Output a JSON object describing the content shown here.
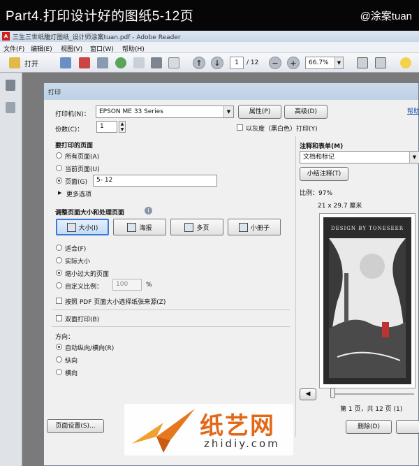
{
  "banner": {
    "title": "Part4.打印设计好的图纸5-12页",
    "author": "@涂案tuan"
  },
  "window": {
    "title": "三生三世纸雕灯图纸_设计师涂案tuan.pdf - Adobe Reader"
  },
  "menu": [
    "文件(F)",
    "编辑(E)",
    "视图(V)",
    "窗口(W)",
    "帮助(H)"
  ],
  "toolbar": {
    "open_label": "打开",
    "page_current": "1",
    "page_total": "/ 12",
    "zoom": "66.7%"
  },
  "dialog": {
    "title": "打印",
    "help_link": "帮助",
    "printer_label": "打印机(N)：",
    "printer_value": "EPSON ME 33 Series",
    "properties_button": "属性(P)",
    "advanced_button": "高级(D)",
    "copies_label": "份数(C)：",
    "copies_value": "1",
    "grayscale_label": "以灰度（黑白色）打印(Y)",
    "pages_heading": "要打印的页面",
    "pages_options": [
      "所有页面(A)",
      "当前页面(U)",
      "页面(G)"
    ],
    "pages_range": "5- 12",
    "more_options": "更多选项",
    "sizing_heading": "调整页面大小和处理页面",
    "sizing_buttons": [
      "大小(I)",
      "海报",
      "多页",
      "小册子"
    ],
    "scale_options": [
      "适合(F)",
      "实际大小",
      "缩小过大的页面",
      "自定义比例："
    ],
    "custom_scale": "100",
    "percent": "%",
    "paper_source": "按照 PDF 页面大小选择纸张来源(Z)",
    "duplex": "双面打印(B)",
    "orientation_label": "方向：",
    "orientation_options": [
      "自动纵向/横向(R)",
      "纵向",
      "横向"
    ],
    "page_setup_button": "页面设置(S)...",
    "comments_heading": "注释和表单(M)",
    "comments_value": "文档和标记",
    "summarize_button": "小结注释(T)",
    "scale_text": "比例：97%",
    "paper_size": "21 x 29.7 厘米",
    "poster_text": "DESIGN BY TONESEER",
    "page_of": "第 1 页，共 12 页 (1)",
    "delete_button": "删除(D)"
  },
  "watermark": {
    "cn": "纸艺网",
    "url": "zhidiy.com"
  }
}
